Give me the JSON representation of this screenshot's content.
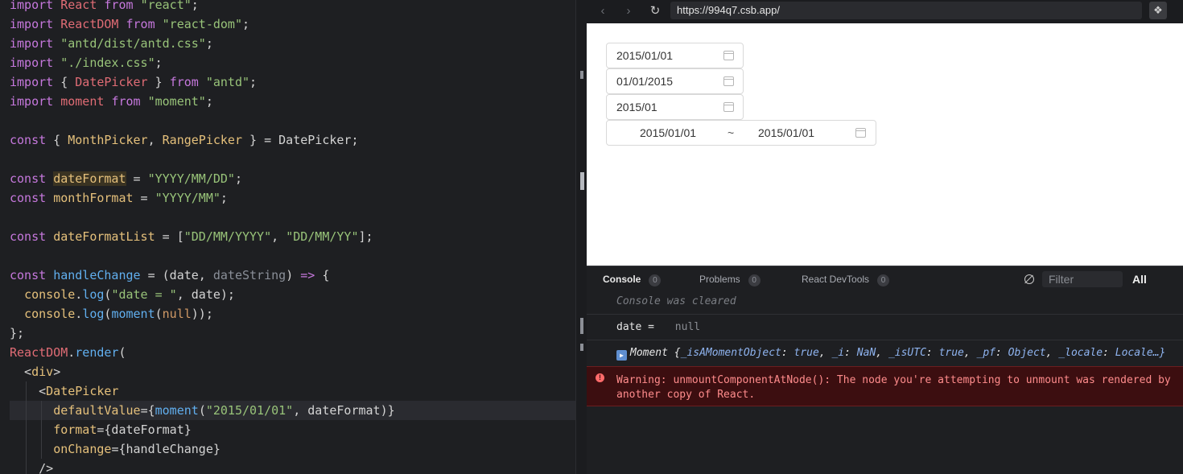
{
  "editor": {
    "lines": [
      {
        "parts": [
          [
            "kw",
            "import"
          ],
          [
            "plain",
            " "
          ],
          [
            "comp",
            "React"
          ],
          [
            "plain",
            " "
          ],
          [
            "kw",
            "from"
          ],
          [
            "plain",
            " "
          ],
          [
            "str",
            "\"react\""
          ],
          [
            "plain",
            ";"
          ]
        ]
      },
      {
        "parts": [
          [
            "kw",
            "import"
          ],
          [
            "plain",
            " "
          ],
          [
            "comp",
            "ReactDOM"
          ],
          [
            "plain",
            " "
          ],
          [
            "kw",
            "from"
          ],
          [
            "plain",
            " "
          ],
          [
            "str",
            "\"react-dom\""
          ],
          [
            "plain",
            ";"
          ]
        ]
      },
      {
        "parts": [
          [
            "kw",
            "import"
          ],
          [
            "plain",
            " "
          ],
          [
            "str",
            "\"antd/dist/antd.css\""
          ],
          [
            "plain",
            ";"
          ]
        ]
      },
      {
        "parts": [
          [
            "kw",
            "import"
          ],
          [
            "plain",
            " "
          ],
          [
            "str",
            "\"./index.css\""
          ],
          [
            "plain",
            ";"
          ]
        ]
      },
      {
        "parts": [
          [
            "kw",
            "import"
          ],
          [
            "plain",
            " { "
          ],
          [
            "comp",
            "DatePicker"
          ],
          [
            "plain",
            " } "
          ],
          [
            "kw",
            "from"
          ],
          [
            "plain",
            " "
          ],
          [
            "str",
            "\"antd\""
          ],
          [
            "plain",
            ";"
          ]
        ]
      },
      {
        "parts": [
          [
            "kw",
            "import"
          ],
          [
            "plain",
            " "
          ],
          [
            "comp",
            "moment"
          ],
          [
            "plain",
            " "
          ],
          [
            "kw",
            "from"
          ],
          [
            "plain",
            " "
          ],
          [
            "str",
            "\"moment\""
          ],
          [
            "plain",
            ";"
          ]
        ]
      },
      {
        "parts": []
      },
      {
        "parts": [
          [
            "kw2",
            "const"
          ],
          [
            "plain",
            " { "
          ],
          [
            "var",
            "MonthPicker"
          ],
          [
            "plain",
            ", "
          ],
          [
            "var",
            "RangePicker"
          ],
          [
            "plain",
            " } = DatePicker;"
          ]
        ]
      },
      {
        "parts": []
      },
      {
        "parts": [
          [
            "kw2",
            "const"
          ],
          [
            "plain",
            " "
          ],
          [
            "hlvar",
            "dateFormat"
          ],
          [
            "plain",
            " = "
          ],
          [
            "str",
            "\"YYYY/MM/DD\""
          ],
          [
            "plain",
            ";"
          ]
        ]
      },
      {
        "parts": [
          [
            "kw2",
            "const"
          ],
          [
            "plain",
            " "
          ],
          [
            "var",
            "monthFormat"
          ],
          [
            "plain",
            " = "
          ],
          [
            "str",
            "\"YYYY/MM\""
          ],
          [
            "plain",
            ";"
          ]
        ]
      },
      {
        "parts": []
      },
      {
        "parts": [
          [
            "kw2",
            "const"
          ],
          [
            "plain",
            " "
          ],
          [
            "var",
            "dateFormatList"
          ],
          [
            "plain",
            " = ["
          ],
          [
            "str",
            "\"DD/MM/YYYY\""
          ],
          [
            "plain",
            ", "
          ],
          [
            "str",
            "\"DD/MM/YY\""
          ],
          [
            "plain",
            "];"
          ]
        ]
      },
      {
        "parts": []
      },
      {
        "parts": [
          [
            "kw2",
            "const"
          ],
          [
            "plain",
            " "
          ],
          [
            "fn",
            "handleChange"
          ],
          [
            "plain",
            " = (date, "
          ],
          [
            "dim",
            "dateString"
          ],
          [
            "plain",
            ") "
          ],
          [
            "kw",
            "=>"
          ],
          [
            "plain",
            " {"
          ]
        ]
      },
      {
        "parts": [
          [
            "plain",
            "  "
          ],
          [
            "var",
            "console"
          ],
          [
            "plain",
            "."
          ],
          [
            "fn",
            "log"
          ],
          [
            "plain",
            "("
          ],
          [
            "str",
            "\"date = \""
          ],
          [
            "plain",
            ", date);"
          ]
        ]
      },
      {
        "parts": [
          [
            "plain",
            "  "
          ],
          [
            "var",
            "console"
          ],
          [
            "plain",
            "."
          ],
          [
            "fn",
            "log"
          ],
          [
            "plain",
            "("
          ],
          [
            "fn",
            "moment"
          ],
          [
            "plain",
            "("
          ],
          [
            "lit",
            "null"
          ],
          [
            "plain",
            "));"
          ]
        ]
      },
      {
        "parts": [
          [
            "plain",
            "};"
          ]
        ]
      },
      {
        "parts": [
          [
            "comp",
            "ReactDOM"
          ],
          [
            "plain",
            "."
          ],
          [
            "fn",
            "render"
          ],
          [
            "plain",
            "("
          ]
        ]
      },
      {
        "parts": [
          [
            "plain",
            "  <"
          ],
          [
            "tag",
            "div"
          ],
          [
            "plain",
            ">"
          ]
        ]
      },
      {
        "parts": [
          [
            "plain",
            "    <"
          ],
          [
            "tag",
            "DatePicker"
          ]
        ]
      },
      {
        "parts": [
          [
            "plain",
            "      "
          ],
          [
            "attr",
            "defaultValue"
          ],
          [
            "plain",
            "={"
          ],
          [
            "fn",
            "moment"
          ],
          [
            "plain",
            "("
          ],
          [
            "str",
            "\"2015/01/01\""
          ],
          [
            "plain",
            ", dateFormat)}"
          ]
        ]
      },
      {
        "parts": [
          [
            "plain",
            "      "
          ],
          [
            "attr",
            "format"
          ],
          [
            "plain",
            "={dateFormat}"
          ]
        ]
      },
      {
        "parts": [
          [
            "plain",
            "      "
          ],
          [
            "attr",
            "onChange"
          ],
          [
            "plain",
            "={handleChange}"
          ]
        ]
      },
      {
        "parts": [
          [
            "plain",
            "    />"
          ]
        ]
      }
    ]
  },
  "browser": {
    "back_glyph": "‹",
    "forward_glyph": "›",
    "reload_glyph": "↻",
    "url": "https://994q7.csb.app/",
    "ext_glyph": "❖",
    "icons": [
      "chevron-left-icon",
      "chevron-right-icon",
      "reload-icon",
      "extension-icon"
    ]
  },
  "preview": {
    "picker_date": "2015/01/01",
    "picker_list": "01/01/2015",
    "picker_month": "2015/01",
    "range_start": "2015/01/01",
    "range_sep": "~",
    "range_end": "2015/01/01"
  },
  "devtools": {
    "tabs": [
      {
        "label": "Console",
        "count": "0"
      },
      {
        "label": "Problems",
        "count": "0"
      },
      {
        "label": "React DevTools",
        "count": "0"
      }
    ],
    "filter_placeholder": "Filter",
    "level": "All",
    "cleared": "Console was cleared",
    "date_label": "date = ",
    "date_value": "null",
    "moment_prefix": "Moment {",
    "moment_fields": [
      {
        "k": "_isAMomentObject",
        "v": "true"
      },
      {
        "k": "_i",
        "v": "NaN"
      },
      {
        "k": "_isUTC",
        "v": "true"
      },
      {
        "k": "_pf",
        "v": "Object"
      },
      {
        "k": "_locale",
        "v": "Locale…}"
      }
    ],
    "warning_line1": "Warning: unmountComponentAtNode(): The node you're attempting to unmount was rendered by",
    "warning_line2": "another copy of React.",
    "warning_icon_glyph": "!"
  }
}
